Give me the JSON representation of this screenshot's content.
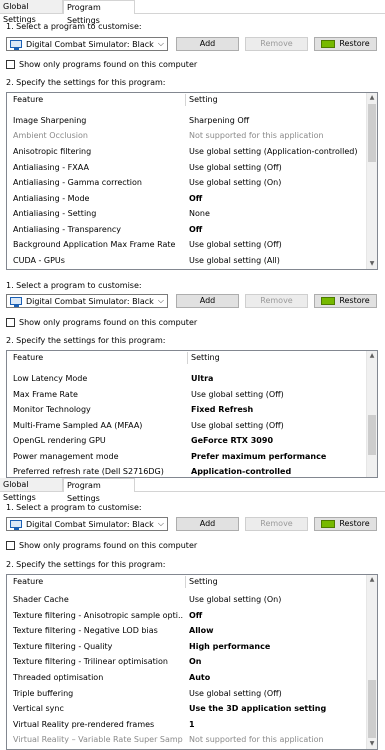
{
  "tabs": {
    "global": "Global Settings",
    "program": "Program Settings"
  },
  "step1": "1. Select a program to customise:",
  "program_select": {
    "value": "Digital Combat Simulator: Black ...",
    "arrow": "⌵"
  },
  "buttons": {
    "add": "Add",
    "remove": "Remove",
    "restore": "Restore"
  },
  "show_only": "Show only programs found on this computer",
  "step2": "2. Specify the settings for this program:",
  "columns": {
    "feature": "Feature",
    "setting": "Setting"
  },
  "scroll": {
    "up": "▲",
    "down": "▼"
  },
  "panels": [
    {
      "scroll_position": 0.0,
      "rows": [
        {
          "feature": "Image Sharpening",
          "setting": "Sharpening Off",
          "bold": false,
          "grey": false
        },
        {
          "feature": "Ambient Occlusion",
          "setting": "Not supported for this application",
          "bold": false,
          "grey": true
        },
        {
          "feature": "Anisotropic filtering",
          "setting": "Use global setting (Application-controlled)",
          "bold": false,
          "grey": false
        },
        {
          "feature": "Antialiasing - FXAA",
          "setting": "Use global setting (Off)",
          "bold": false,
          "grey": false
        },
        {
          "feature": "Antialiasing - Gamma correction",
          "setting": "Use global setting (On)",
          "bold": false,
          "grey": false
        },
        {
          "feature": "Antialiasing - Mode",
          "setting": "Off",
          "bold": true,
          "grey": false
        },
        {
          "feature": "Antialiasing - Setting",
          "setting": "None",
          "bold": false,
          "grey": false
        },
        {
          "feature": "Antialiasing - Transparency",
          "setting": "Off",
          "bold": true,
          "grey": false
        },
        {
          "feature": "Background Application Max Frame Rate",
          "setting": "Use global setting (Off)",
          "bold": false,
          "grey": false
        },
        {
          "feature": "CUDA - GPUs",
          "setting": "Use global setting (All)",
          "bold": false,
          "grey": false
        }
      ]
    },
    {
      "scroll_position": 0.55,
      "rows": [
        {
          "feature": "Low Latency Mode",
          "setting": "Ultra",
          "bold": true,
          "grey": false
        },
        {
          "feature": "Max Frame Rate",
          "setting": "Use global setting (Off)",
          "bold": false,
          "grey": false
        },
        {
          "feature": "Monitor Technology",
          "setting": "Fixed Refresh",
          "bold": true,
          "grey": false
        },
        {
          "feature": "Multi-Frame Sampled AA (MFAA)",
          "setting": "Use global setting (Off)",
          "bold": false,
          "grey": false
        },
        {
          "feature": "OpenGL rendering GPU",
          "setting": "GeForce RTX 3090",
          "bold": true,
          "grey": false
        },
        {
          "feature": "Power management mode",
          "setting": "Prefer maximum performance",
          "bold": true,
          "grey": false
        },
        {
          "feature": "Preferred refresh rate (Dell S2716DG)",
          "setting": "Application-controlled",
          "bold": true,
          "grey": false
        }
      ]
    },
    {
      "scroll_position": 1.0,
      "rows": [
        {
          "feature": "Shader Cache",
          "setting": "Use global setting (On)",
          "bold": false,
          "grey": false
        },
        {
          "feature": "Texture filtering - Anisotropic sample opti...",
          "setting": "Off",
          "bold": true,
          "grey": false
        },
        {
          "feature": "Texture filtering - Negative LOD bias",
          "setting": "Allow",
          "bold": true,
          "grey": false
        },
        {
          "feature": "Texture filtering - Quality",
          "setting": "High performance",
          "bold": true,
          "grey": false
        },
        {
          "feature": "Texture filtering - Trilinear optimisation",
          "setting": "On",
          "bold": true,
          "grey": false
        },
        {
          "feature": "Threaded optimisation",
          "setting": "Auto",
          "bold": true,
          "grey": false
        },
        {
          "feature": "Triple buffering",
          "setting": "Use global setting (Off)",
          "bold": false,
          "grey": false
        },
        {
          "feature": "Vertical sync",
          "setting": "Use the 3D application setting",
          "bold": true,
          "grey": false
        },
        {
          "feature": "Virtual Reality pre-rendered frames",
          "setting": "1",
          "bold": true,
          "grey": false
        },
        {
          "feature": "Virtual Reality – Variable Rate Super Samp...",
          "setting": "Not supported for this application",
          "bold": false,
          "grey": true
        }
      ]
    }
  ]
}
